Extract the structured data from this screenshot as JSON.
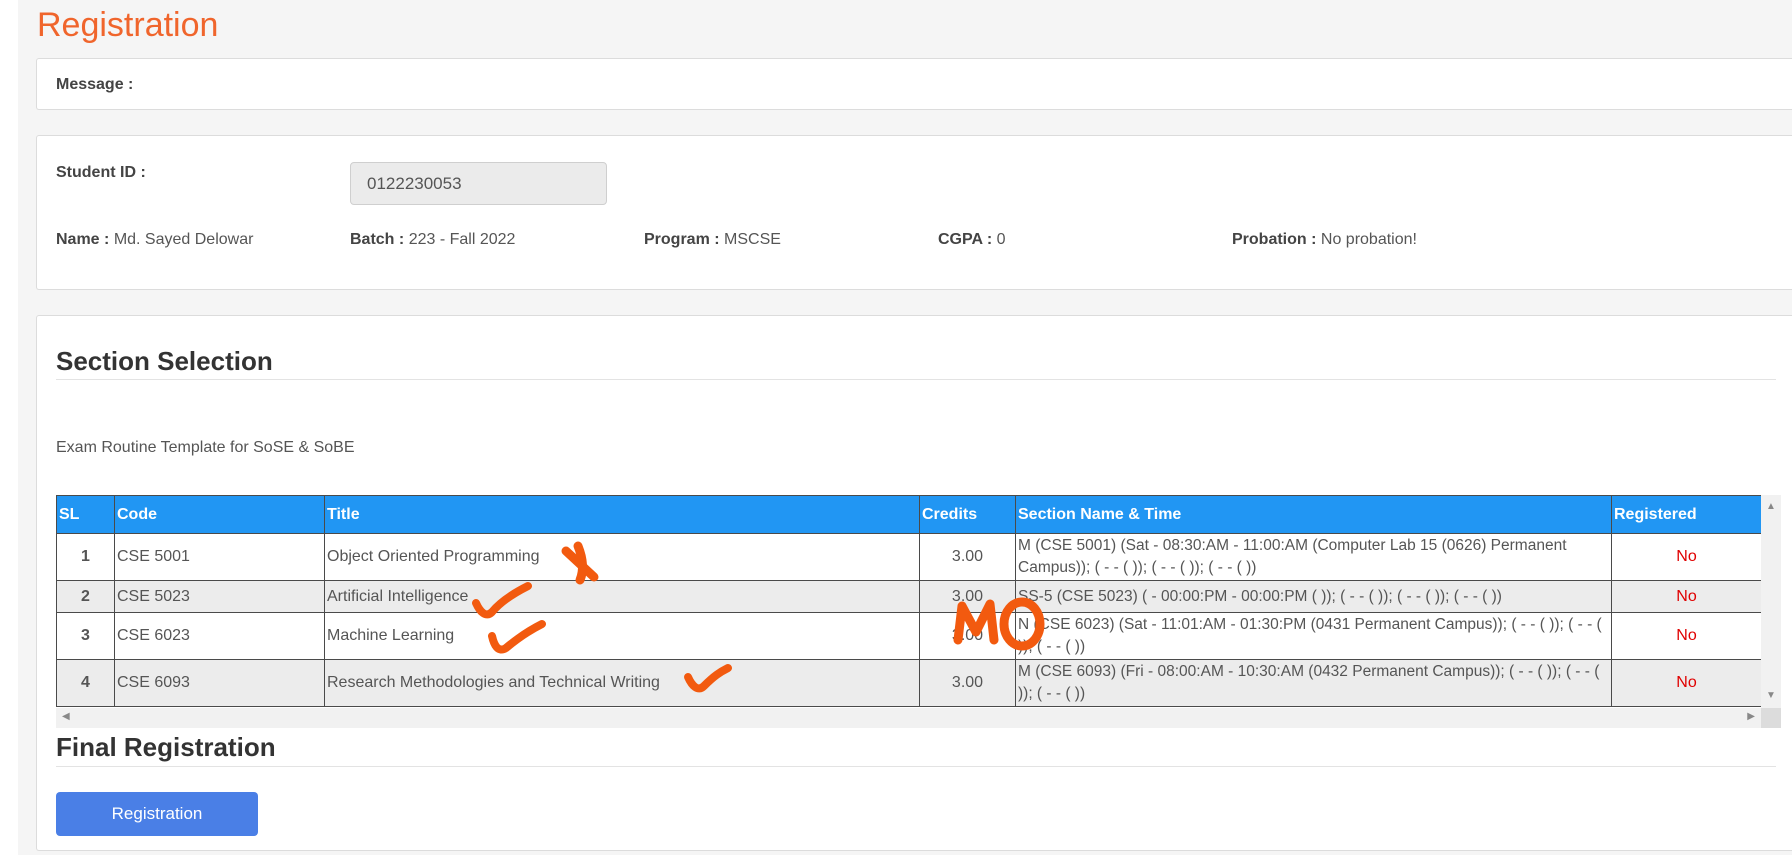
{
  "page": {
    "title": "Registration"
  },
  "message": {
    "label": "Message :"
  },
  "student": {
    "id_label": "Student ID :",
    "id_value": "0122230053",
    "name_label": "Name :",
    "name_value": "Md. Sayed Delowar",
    "batch_label": "Batch :",
    "batch_value": "223 - Fall 2022",
    "program_label": "Program :",
    "program_value": "MSCSE",
    "cgpa_label": "CGPA :",
    "cgpa_value": "0",
    "probation_label": "Probation :",
    "probation_value": "No probation!"
  },
  "section_selection": {
    "title": "Section Selection",
    "template_link": "Exam Routine Template for SoSE & SoBE",
    "columns": [
      "SL",
      "Code",
      "Title",
      "Credits",
      "Section Name & Time",
      "Registered"
    ],
    "rows": [
      {
        "sl": "1",
        "code": "CSE 5001",
        "title": "Object Oriented Programming",
        "credits": "3.00",
        "section": "M (CSE 5001) (Sat - 08:30:AM - 11:00:AM (Computer Lab 15 (0626) Permanent Campus)); ( - - ( )); ( - - ( )); ( - - ( ))",
        "registered": "No"
      },
      {
        "sl": "2",
        "code": "CSE 5023",
        "title": "Artificial Intelligence",
        "credits": "3.00",
        "section": "SS-5 (CSE 5023) ( - 00:00:PM - 00:00:PM ( )); ( - - ( )); ( - - ( )); ( - - ( ))",
        "registered": "No"
      },
      {
        "sl": "3",
        "code": "CSE 6023",
        "title": "Machine Learning",
        "credits": "3.00",
        "section": "N (CSE 6023) (Sat - 11:01:AM - 01:30:PM (0431 Permanent Campus)); ( - - ( )); ( - - ( )); ( - - ( ))",
        "registered": "No"
      },
      {
        "sl": "4",
        "code": "CSE 6093",
        "title": "Research Methodologies and Technical Writing",
        "credits": "3.00",
        "section": "M (CSE 6093) (Fri - 08:00:AM - 10:30:AM (0432 Permanent Campus)); ( - - ( )); ( - - ( )); ( - - ( ))",
        "registered": "No"
      }
    ]
  },
  "final_registration": {
    "title": "Final Registration",
    "button_label": "Registration"
  },
  "annotations": {
    "handwritten_mark_text": "MO",
    "ink_color": "#f25a0f"
  },
  "colors": {
    "title_accent": "#f0652c",
    "table_header": "#2196f3",
    "button": "#4a7fe6",
    "registered_no": "#e00000"
  }
}
